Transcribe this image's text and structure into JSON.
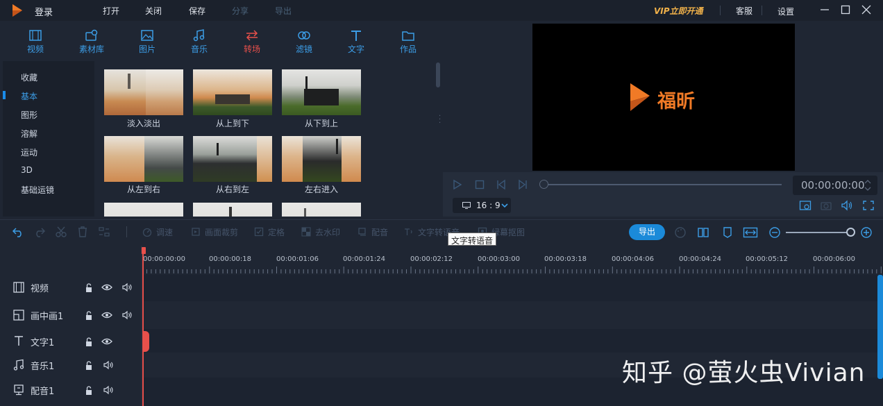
{
  "titlebar": {
    "login": "登录",
    "menu": [
      "打开",
      "关闭",
      "保存",
      "分享",
      "导出"
    ],
    "vip": "VIP立即开通",
    "service": "客服",
    "settings": "设置"
  },
  "categories": [
    {
      "label": "视频",
      "icon": "film-icon"
    },
    {
      "label": "素材库",
      "icon": "library-icon"
    },
    {
      "label": "图片",
      "icon": "image-icon"
    },
    {
      "label": "音乐",
      "icon": "music-icon"
    },
    {
      "label": "转场",
      "icon": "transition-icon",
      "active": true
    },
    {
      "label": "滤镜",
      "icon": "filter-icon"
    },
    {
      "label": "文字",
      "icon": "text-icon"
    },
    {
      "label": "作品",
      "icon": "folder-icon"
    }
  ],
  "subcategories": [
    "收藏",
    "基本",
    "图形",
    "溶解",
    "运动",
    "3D",
    "基础运镜"
  ],
  "active_subcategory": "基本",
  "transitions": [
    "淡入淡出",
    "从上到下",
    "从下到上",
    "从左到右",
    "从右到左",
    "左右进入"
  ],
  "preview": {
    "brand": "福昕",
    "timecode": "00:00:00:00",
    "aspect_ratio": "16 : 9"
  },
  "toolbar": {
    "items": [
      "调速",
      "画面裁剪",
      "定格",
      "去水印",
      "配音",
      "文字转语音",
      "绿幕抠图"
    ],
    "tooltip": "文字转语音",
    "export": "导出"
  },
  "ruler_labels": [
    "00:00:00:00",
    "00:00:00:18",
    "00:00:01:06",
    "00:00:01:24",
    "00:00:02:12",
    "00:00:03:00",
    "00:00:03:18",
    "00:00:04:06",
    "00:00:04:24",
    "00:00:05:12",
    "00:00:06:00"
  ],
  "tracks": [
    "视频",
    "画中画1",
    "文字1",
    "音乐1",
    "配音1"
  ],
  "watermark": "知乎 @萤火虫Vivian",
  "colors": {
    "accent": "#1b8ad9",
    "active": "#e8504b",
    "vip": "#f2b24a",
    "brand": "#f07a26"
  }
}
